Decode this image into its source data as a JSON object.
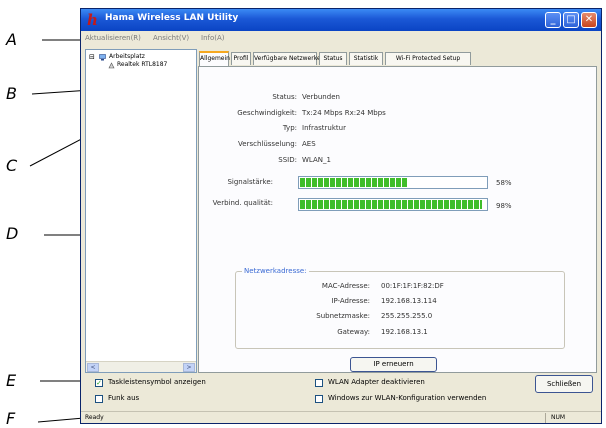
{
  "window": {
    "title": "Hama Wireless LAN Utility",
    "logo": "h",
    "controls": {
      "minimize": "_",
      "maximize": "□",
      "close": "✕"
    }
  },
  "menu": [
    "Aktualisieren(R)",
    "Ansicht(V)",
    "Info(A)"
  ],
  "tree": {
    "root": "Arbeitsplatz",
    "adapter": "Realtek RTL8187"
  },
  "tabs": [
    "Allgemein",
    "Profil",
    "Verfügbare Netzwerke",
    "Status",
    "Statistik",
    "Wi-Fi Protected Setup"
  ],
  "active_tab": "Allgemein",
  "general": {
    "status": {
      "label": "Status:",
      "value": "Verbunden"
    },
    "speed": {
      "label": "Geschwindigkeit:",
      "value": "Tx:24 Mbps Rx:24 Mbps"
    },
    "type": {
      "label": "Typ:",
      "value": "Infrastruktur"
    },
    "encryption": {
      "label": "Verschlüsselung:",
      "value": "AES"
    },
    "ssid": {
      "label": "SSID:",
      "value": "WLAN_1"
    },
    "signal": {
      "label": "Signalstärke:",
      "value": 58,
      "text": "58%"
    },
    "quality": {
      "label": "Verbind. qualität:",
      "value": 98,
      "text": "98%"
    }
  },
  "network": {
    "title": "Netzwerkadresse:",
    "rows": [
      {
        "label": "MAC-Adresse:",
        "value": "00:1F:1F:1F:82:DF"
      },
      {
        "label": "IP-Adresse:",
        "value": "192.168.13.114"
      },
      {
        "label": "Subnetzmaske:",
        "value": "255.255.255.0"
      },
      {
        "label": "Gateway:",
        "value": "192.168.13.1"
      }
    ]
  },
  "renew_button": "IP erneuern",
  "options": {
    "taskbar_icon": {
      "label": "Taskleistensymbol anzeigen",
      "checked": true
    },
    "radio_off": {
      "label": "Funk aus",
      "checked": false
    },
    "disable_adapter": {
      "label": "WLAN Adapter deaktivieren",
      "checked": false
    },
    "windows_config": {
      "label": "Windows zur WLAN-Konfiguration verwenden",
      "checked": false
    }
  },
  "close_button": "Schließen",
  "statusbar": {
    "text": "Ready",
    "num": "NUM"
  },
  "callouts": [
    "A",
    "B",
    "C",
    "D",
    "E",
    "F"
  ],
  "colors": {
    "accent": "#f6a820",
    "bar_fill": "#3fbd2a",
    "title_bar": "#1b58d6",
    "group_title": "#3a6ad4"
  }
}
